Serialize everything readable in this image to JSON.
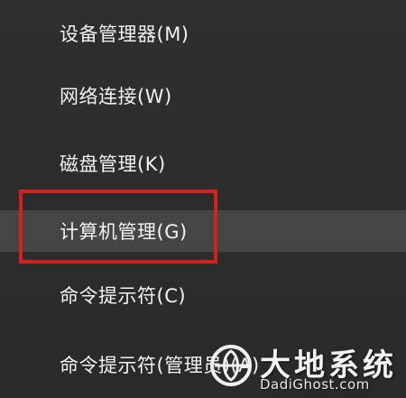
{
  "menu": {
    "items": [
      {
        "label": "设备管理器(M)"
      },
      {
        "label": "网络连接(W)"
      },
      {
        "label": "磁盘管理(K)"
      },
      {
        "label": "计算机管理(G)"
      },
      {
        "label": "命令提示符(C)"
      },
      {
        "label": "命令提示符(管理员)(A)"
      }
    ],
    "highlighted_index": 3
  },
  "watermark": {
    "title": "大地系统",
    "url": "DadiGhost.com"
  },
  "colors": {
    "menu_bg": "#2b2b2b",
    "highlight_bg": "#454545",
    "text": "#f2f2f2",
    "annotation_box": "#d62020"
  }
}
